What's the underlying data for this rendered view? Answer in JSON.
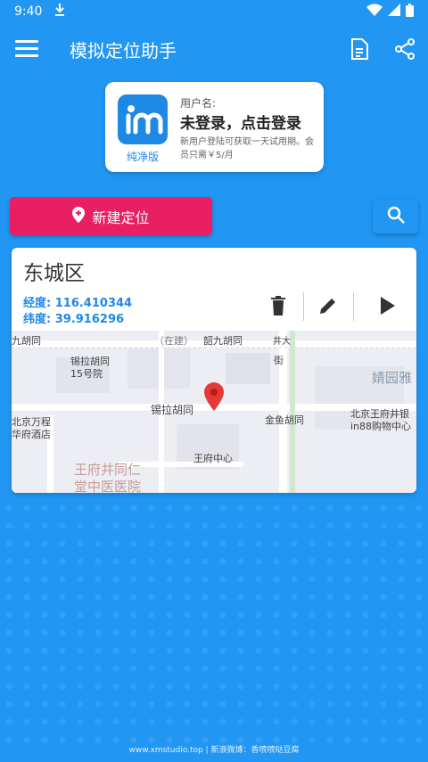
{
  "status_bar": {
    "time": "9:40"
  },
  "app_bar": {
    "title": "模拟定位助手"
  },
  "user_card": {
    "logo_caption": "纯净版",
    "username_label": "用户名:",
    "status": "未登录，点击登录",
    "hint": "新用户登陆可获取一天试用期。会员只需￥5/月"
  },
  "actions": {
    "new_location_label": "新建定位"
  },
  "location_card": {
    "name": "东城区",
    "longitude_label": "经度:",
    "longitude": "116.410344",
    "latitude_label": "纬度:",
    "latitude": "39.916296"
  },
  "map_labels": {
    "jiuhutong": "九胡同",
    "zaijian": "（在建）",
    "shao_jiu": "韶九胡同",
    "jing_da": "井大",
    "jie": "街",
    "xila_15": "锡拉胡同",
    "xila_15b": "15号院",
    "jingyuan": "婧园雅",
    "wanfang": "北京万程",
    "wanfang2": "华府酒店",
    "xila": "锡拉胡同",
    "jinyu": "金鱼胡同",
    "in88": "北京王府井银",
    "in88b": "in88购物中心",
    "wangfu_center": "王府中心",
    "hospital1": "王府井同仁",
    "hospital2": "堂中医医院"
  },
  "footer": {
    "text": "www.xmstudio.top | 新浪微博：香喷喷哒豆腐"
  }
}
